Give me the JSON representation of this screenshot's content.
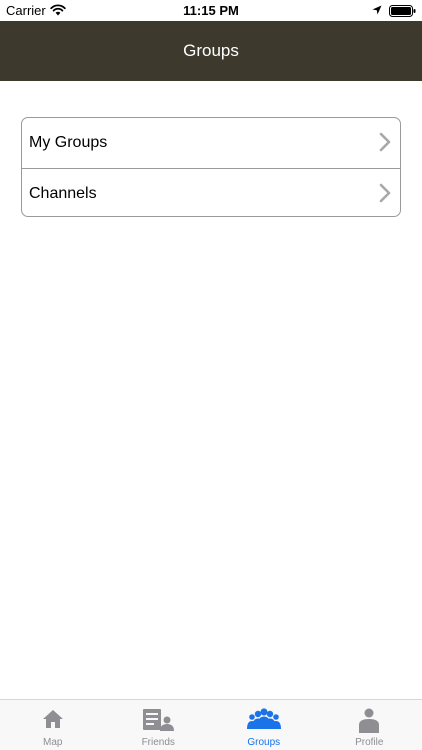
{
  "status_bar": {
    "carrier": "Carrier",
    "time": "11:15 PM"
  },
  "nav": {
    "title": "Groups"
  },
  "menu": {
    "items": [
      {
        "label": "My Groups",
        "icon": "chevron-right-icon"
      },
      {
        "label": "Channels",
        "icon": "chevron-right-icon"
      }
    ]
  },
  "tab_bar": {
    "tabs": [
      {
        "label": "Map",
        "icon": "house-icon",
        "active": false
      },
      {
        "label": "Friends",
        "icon": "friends-list-icon",
        "active": false
      },
      {
        "label": "Groups",
        "icon": "group-people-icon",
        "active": true
      },
      {
        "label": "Profile",
        "icon": "person-icon",
        "active": false
      }
    ]
  },
  "colors": {
    "nav_background": "#3d3a2d",
    "active_tab": "#1a73e8",
    "inactive_tab": "#8e8e93"
  }
}
